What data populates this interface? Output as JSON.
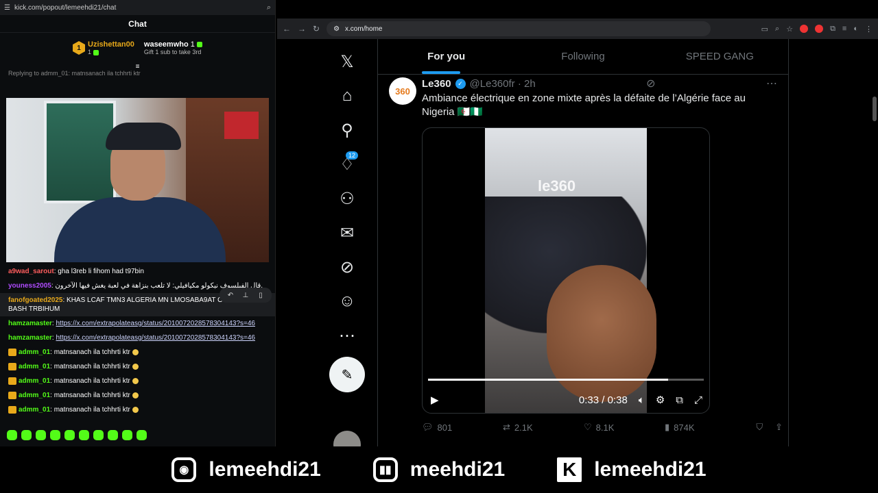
{
  "kick": {
    "url": "kick.com/popout/lemeehdi21/chat",
    "title": "Chat",
    "leaders": [
      {
        "rank": "1",
        "name": "Uzishettan00",
        "count": "1"
      },
      {
        "name": "waseemwho",
        "count": "1",
        "sub": "Gift 1 sub to take 3rd"
      }
    ],
    "reply_to": "Replying to admm_01: matnsanach ila tchhrti ktr",
    "messages": [
      {
        "user": "a9wad_sarout",
        "color": "#ff5d5d",
        "text": "gha l3reb li fihom had t97bin"
      },
      {
        "user": "youness2005",
        "color": "#b04cff",
        "text": "قال الفيلسوف نيكولو مكيافيلي: لا تلعب بنزاهة في لعبة يغش فيها الآخرون."
      },
      {
        "user": "fanofgoated2025",
        "color": "#e8a91a",
        "text": "KHAS LCAF TMN3 ALGERIA MN LMOSABA9AT OULI DYALHA BASH TRBIHUM"
      },
      {
        "user": "hamzamaster",
        "color": "#53fc18",
        "link": "https://x.com/extrapolateasg/status/2010072028578304143?s=46"
      },
      {
        "user": "hamzamaster",
        "color": "#53fc18",
        "link": "https://x.com/extrapolateasg/status/2010072028578304143?s=46"
      },
      {
        "user": "admm_01",
        "color": "#53fc18",
        "text": "matnsanach ila tchhrti ktr"
      },
      {
        "user": "admm_01",
        "color": "#53fc18",
        "text": "matnsanach ila tchhrti ktr"
      },
      {
        "user": "admm_01",
        "color": "#53fc18",
        "text": "matnsanach ila tchhrti ktr"
      },
      {
        "user": "admm_01",
        "color": "#53fc18",
        "text": "matnsanach ila tchhrti ktr"
      },
      {
        "user": "admm_01",
        "color": "#53fc18",
        "text": "matnsanach ila tchhrti ktr"
      }
    ]
  },
  "browser": {
    "url": "x.com/home"
  },
  "x": {
    "tabs": [
      "For you",
      "Following",
      "SPEED GANG"
    ],
    "notif_badge": "12",
    "tweet": {
      "avatar_text": "360",
      "name": "Le360",
      "handle": "@Le360fr · 2h",
      "text": "Ambiance électrique en zone mixte après la défaite de l’Algérie face au Nigeria 🇩🇿🇳🇬",
      "watermark": "le360",
      "time": "0:33 / 0:38",
      "progress": 0.87,
      "replies": "801",
      "reposts": "2.1K",
      "likes": "8.1K",
      "views": "874K"
    }
  },
  "socials": [
    {
      "icon": "instagram-icon",
      "handle": "lemeehdi21"
    },
    {
      "icon": "twitch-icon",
      "handle": "meehdi21"
    },
    {
      "icon": "kick-icon",
      "handle": "lemeehdi21"
    }
  ]
}
